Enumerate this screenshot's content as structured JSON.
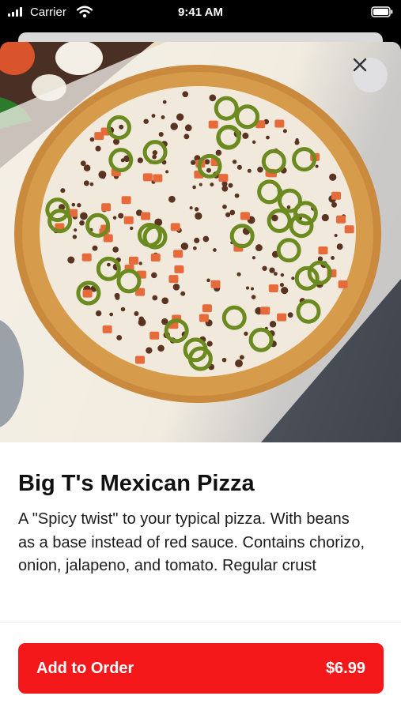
{
  "status_bar": {
    "carrier": "Carrier",
    "time": "9:41 AM"
  },
  "item": {
    "name": "Big T's Mexican Pizza",
    "description": "A \"Spicy twist\" to your typical pizza. With beans as a base instead of red sauce. Contains chorizo, onion, jalapeno, and tomato. Regular crust",
    "image_icon": "pizza-photo"
  },
  "actions": {
    "close_icon": "close-icon",
    "add_label": "Add to Order",
    "price": "$6.99"
  },
  "colors": {
    "accent": "#f5181b",
    "close_bg": "#e1e1e4"
  }
}
